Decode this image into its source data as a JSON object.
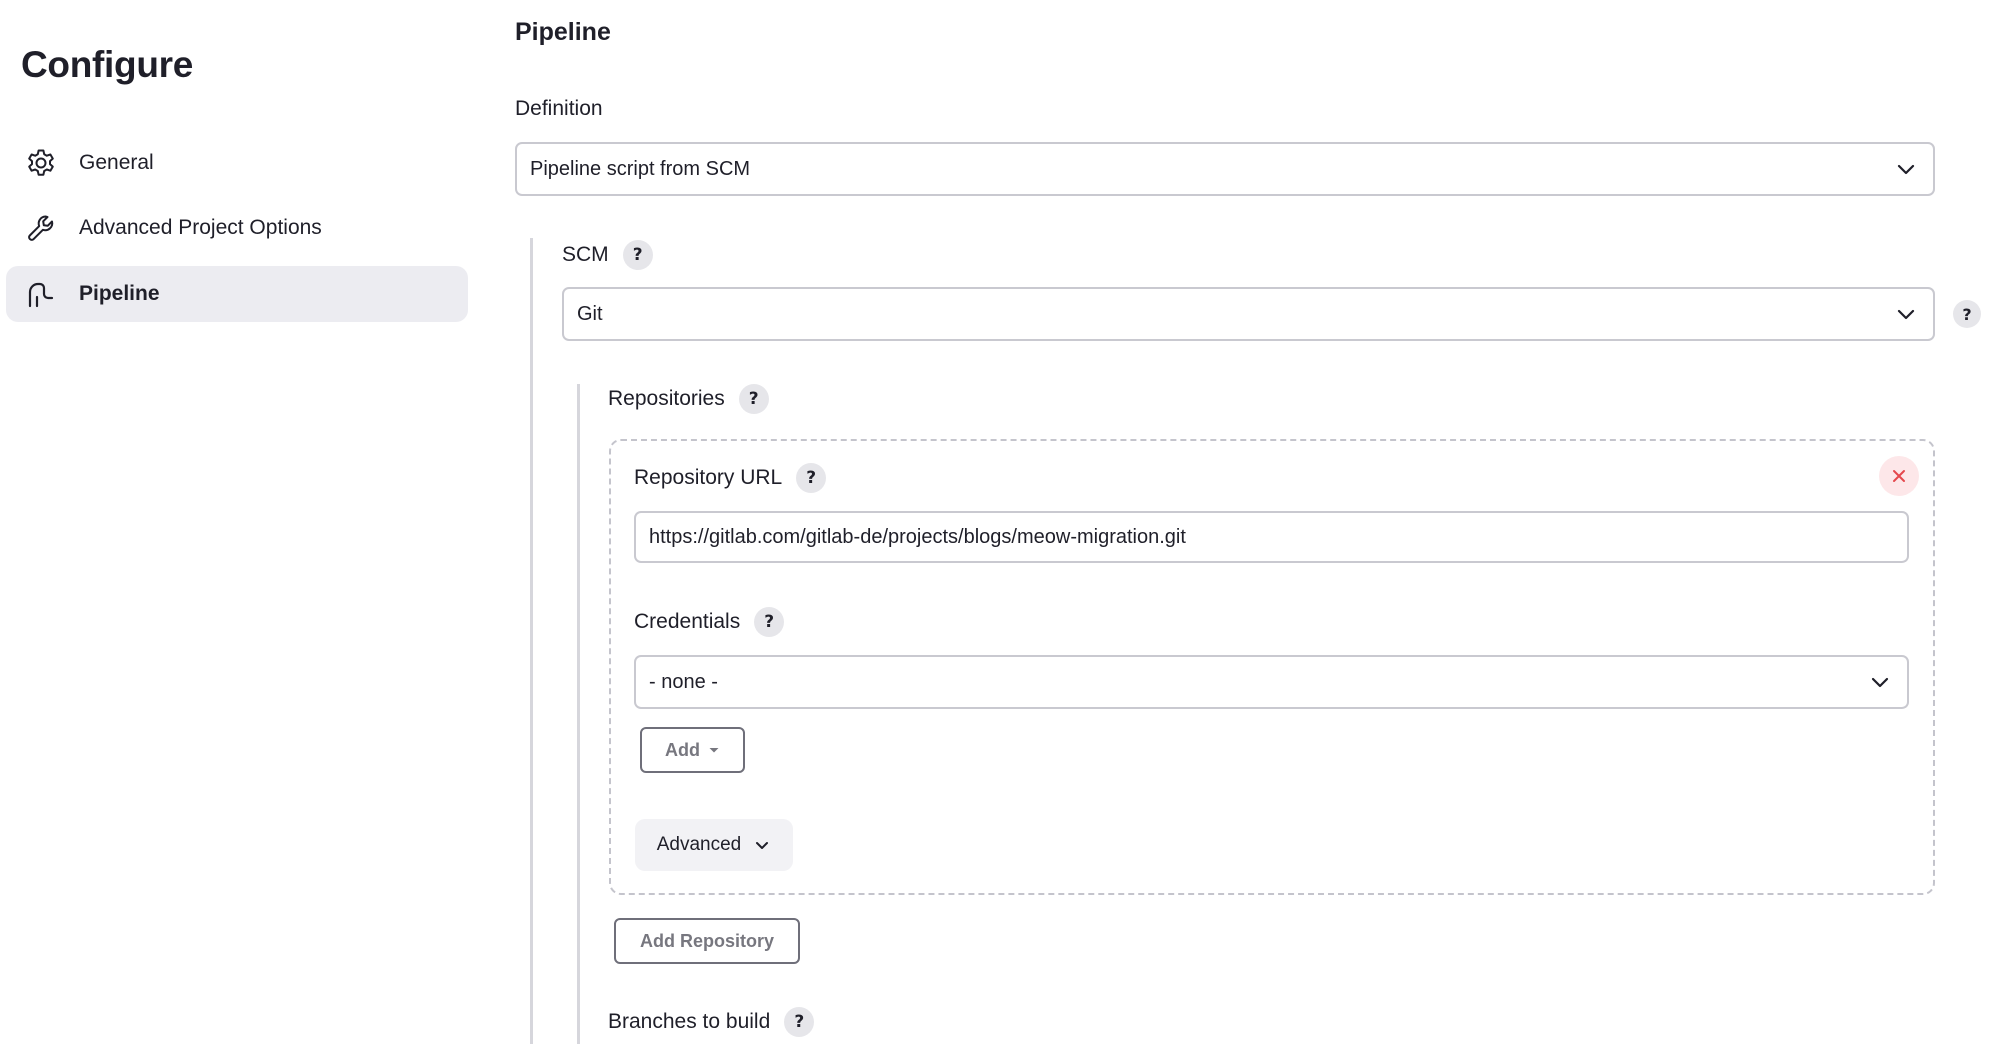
{
  "sidebar": {
    "title": "Configure",
    "items": [
      {
        "label": "General",
        "icon": "gear-icon",
        "active": false
      },
      {
        "label": "Advanced Project Options",
        "icon": "wrench-icon",
        "active": false
      },
      {
        "label": "Pipeline",
        "icon": "pipeline-icon",
        "active": true
      }
    ]
  },
  "main": {
    "section_title": "Pipeline",
    "definition": {
      "label": "Definition",
      "value": "Pipeline script from SCM"
    },
    "scm": {
      "label": "SCM",
      "help": "?",
      "value": "Git",
      "side_help": "?"
    },
    "repositories": {
      "label": "Repositories",
      "help": "?",
      "repository_url": {
        "label": "Repository URL",
        "help": "?",
        "value": "https://gitlab.com/gitlab-de/projects/blogs/meow-migration.git"
      },
      "credentials": {
        "label": "Credentials",
        "help": "?",
        "value": "- none -",
        "add_label": "Add"
      },
      "advanced_label": "Advanced",
      "add_repository_label": "Add Repository"
    },
    "branches": {
      "label": "Branches to build",
      "help": "?"
    }
  },
  "colors": {
    "text": "#1f1f29",
    "active_nav_bg": "#ececf1",
    "border": "#c9c9d0",
    "help_bg": "#e6e6ea",
    "remove_bg": "#fde7e9",
    "remove_x": "#e5484d"
  }
}
